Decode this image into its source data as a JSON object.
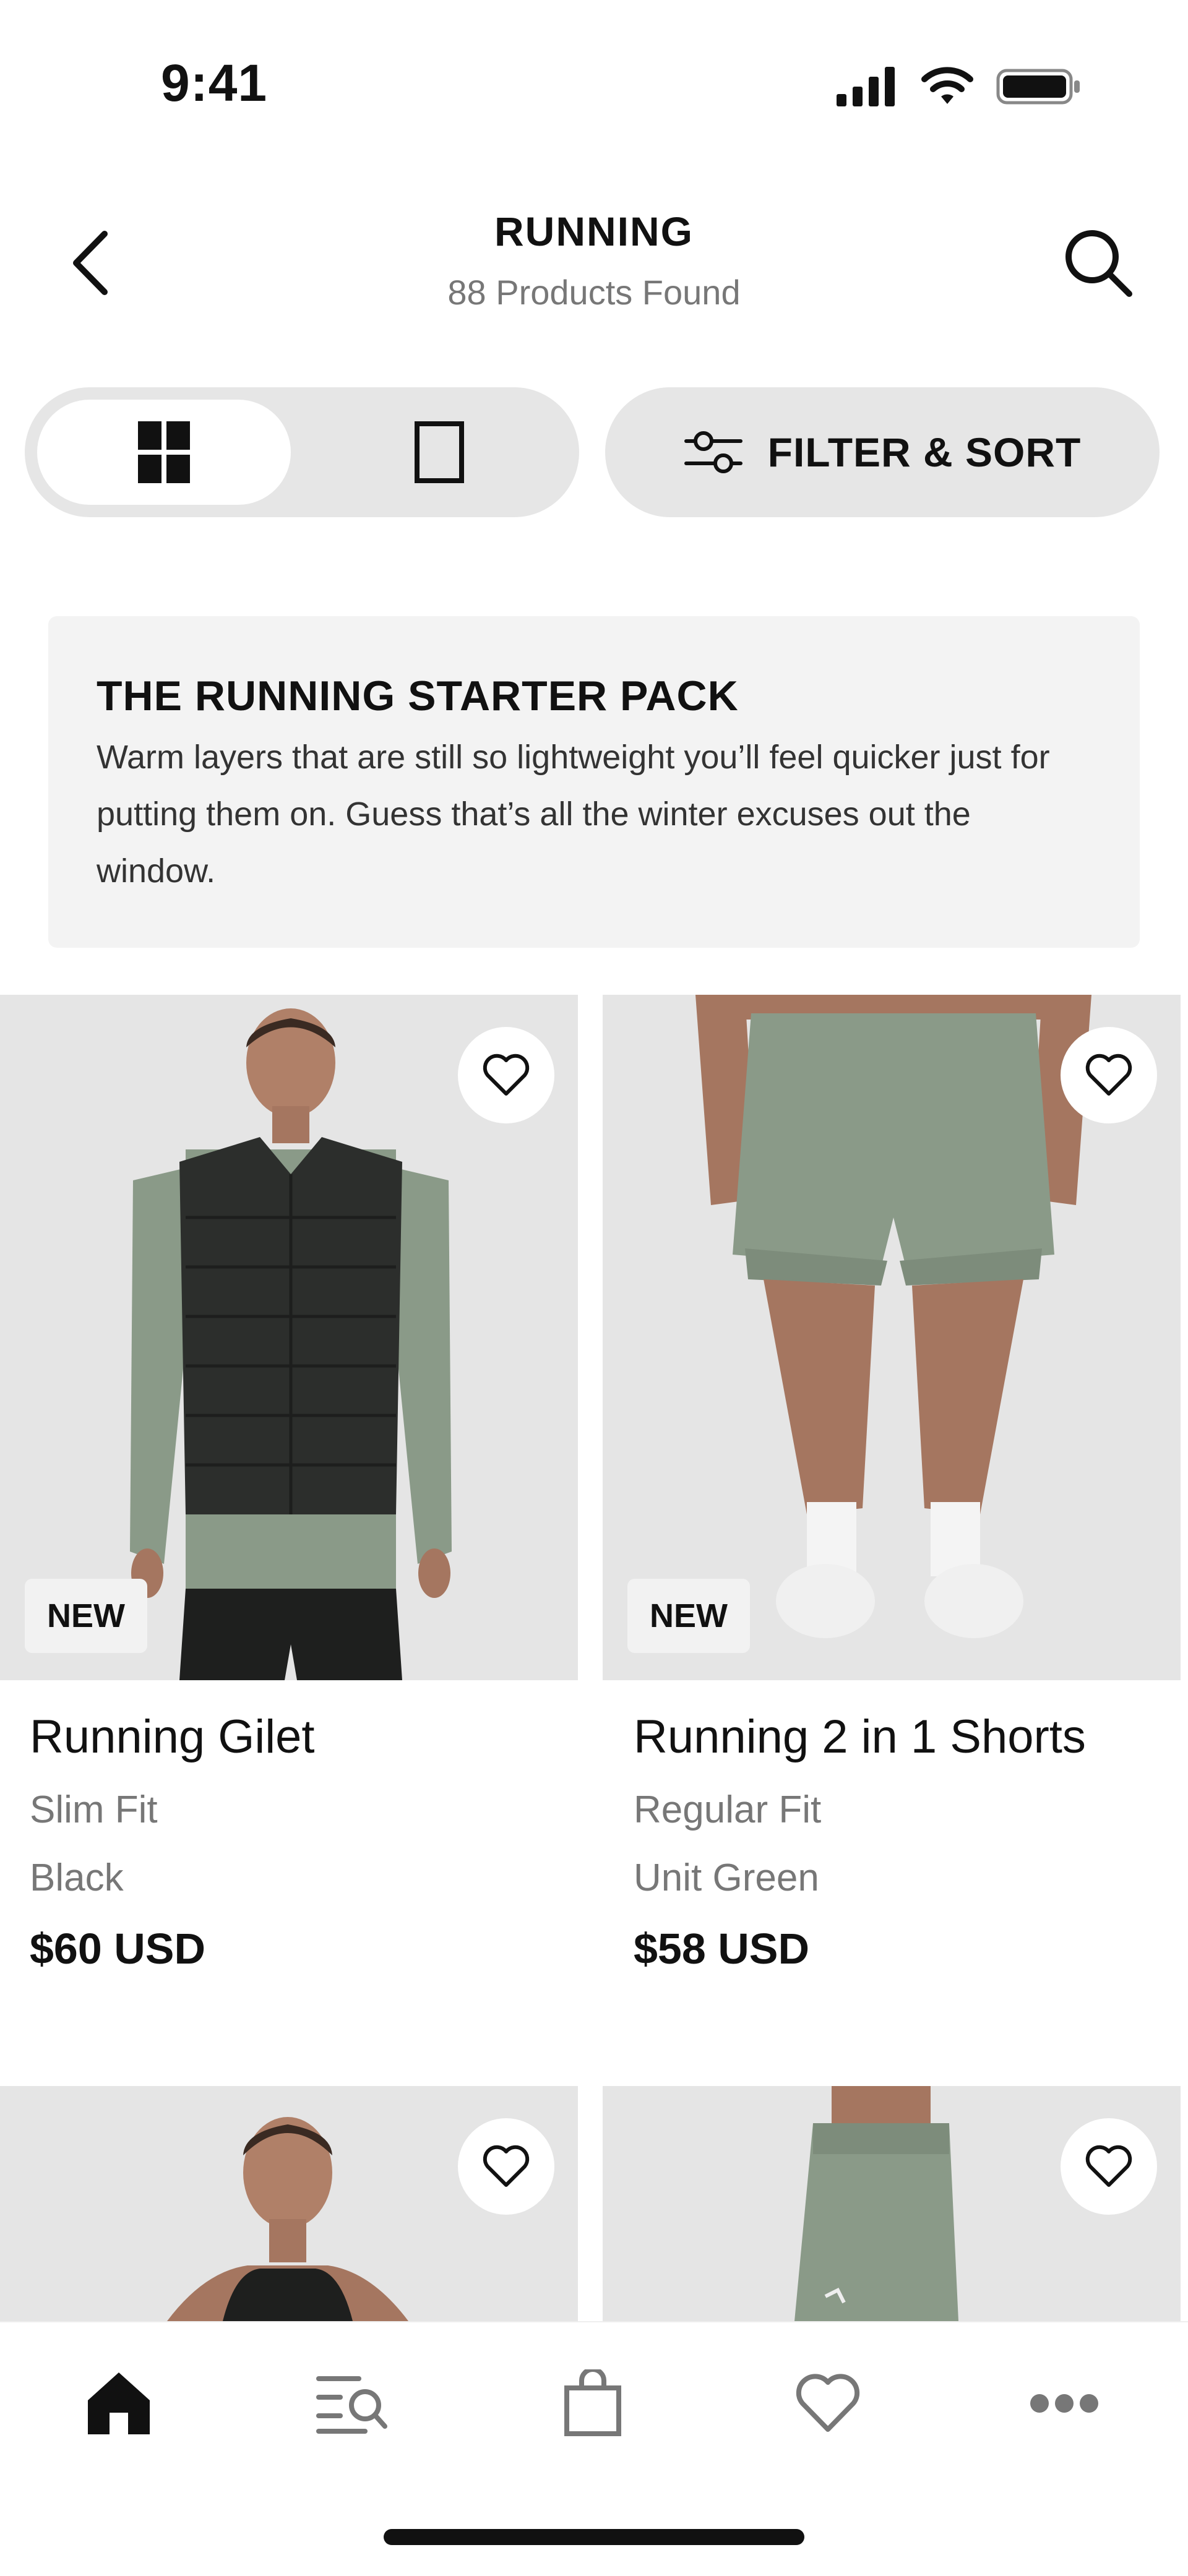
{
  "status": {
    "time": "9:41"
  },
  "header": {
    "title": "RUNNING",
    "subtitle": "88 Products Found"
  },
  "toolbar": {
    "filter_label": "FILTER & SORT"
  },
  "promo": {
    "title": "THE RUNNING STARTER PACK",
    "text": "Warm layers that are still so lightweight you’ll feel quicker just for putting them on. Guess that’s all the winter excuses out the window."
  },
  "products": [
    {
      "badge": "NEW",
      "name": "Running Gilet",
      "fit": "Slim Fit",
      "color": "Black",
      "price": "$60 USD"
    },
    {
      "badge": "NEW",
      "name": "Running 2 in 1 Shorts",
      "fit": "Regular Fit",
      "color": "Unit Green",
      "price": "$58 USD"
    }
  ],
  "icons": {
    "back": "chevron-left-icon",
    "search": "search-icon",
    "grid": "grid-view-icon",
    "single": "single-view-icon",
    "filter": "sliders-icon",
    "heart": "heart-icon",
    "home": "home-icon",
    "browse": "browse-search-icon",
    "bag": "bag-icon",
    "wishlist": "heart-icon",
    "more": "more-icon"
  },
  "colors": {
    "accent": "#111111",
    "muted": "#777777",
    "card_bg": "#e5e5e5",
    "pill_bg": "#e6e6e6",
    "olive": "#8a9a88"
  }
}
